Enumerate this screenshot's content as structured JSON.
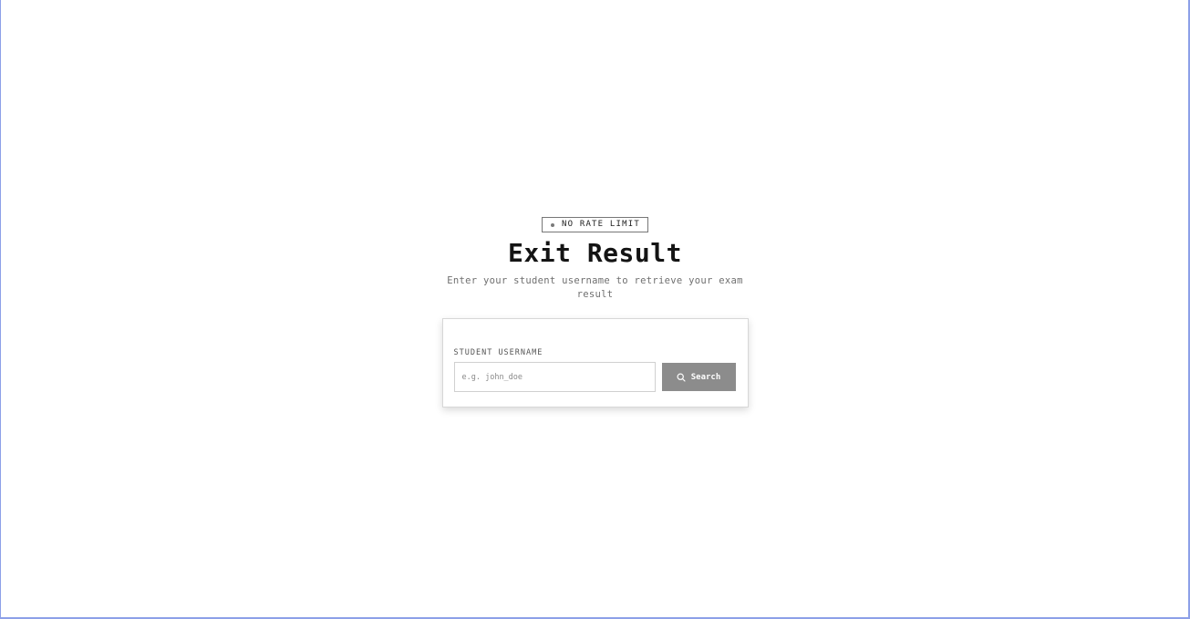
{
  "badge": {
    "label": "NO RATE LIMIT"
  },
  "header": {
    "title": "Exit Result",
    "subtitle": "Enter your student username to retrieve your exam result"
  },
  "form": {
    "field_label": "STUDENT USERNAME",
    "input_value": "",
    "input_placeholder": "e.g. john_doe",
    "search_label": "Search",
    "search_icon": "search-icon"
  },
  "colors": {
    "button_background": "#8c8c8c",
    "frame_border": "#8da0e8"
  }
}
